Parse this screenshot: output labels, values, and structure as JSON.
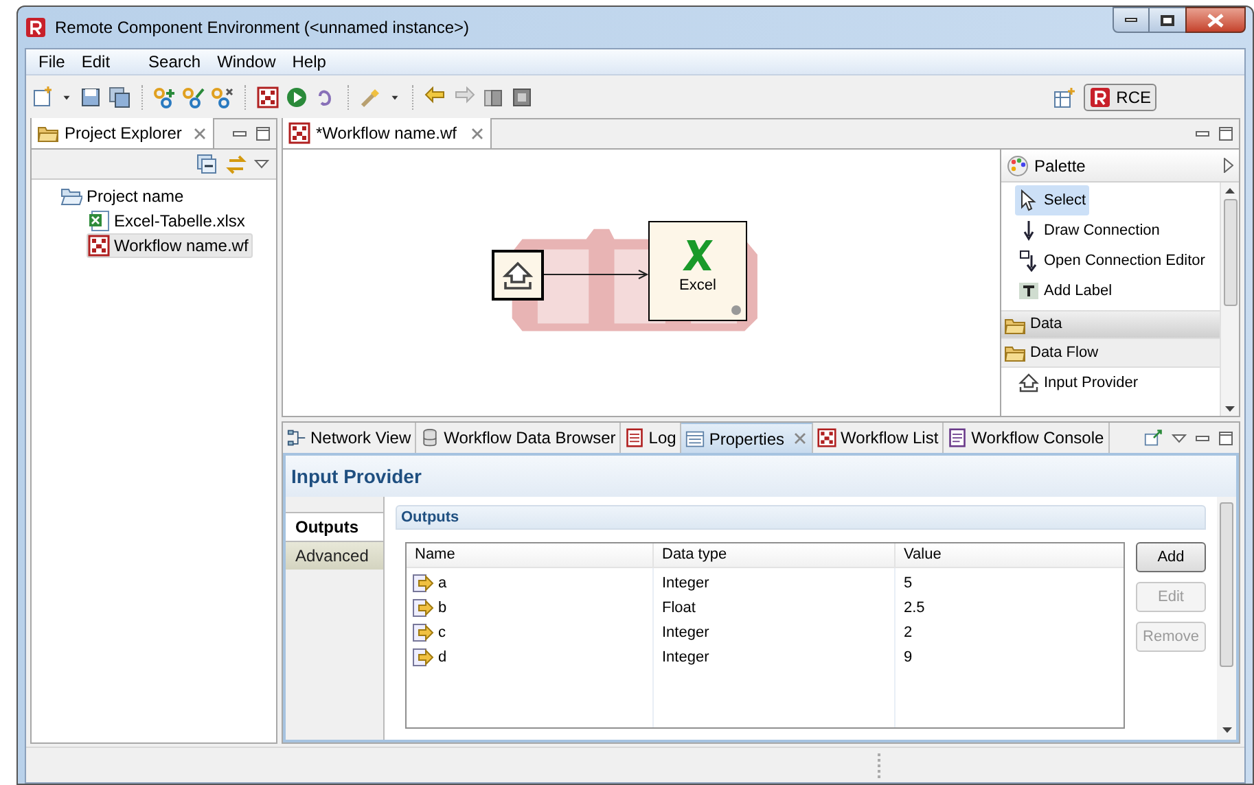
{
  "window": {
    "title": "Remote Component Environment (<unnamed instance>)"
  },
  "menu": [
    "File",
    "Edit",
    "Search",
    "Window",
    "Help"
  ],
  "perspective": {
    "label": "RCE",
    "selected": true
  },
  "project_explorer": {
    "title": "Project Explorer",
    "tree": [
      {
        "label": "Project name",
        "kind": "folder",
        "expanded": true,
        "selected": false,
        "children": [
          {
            "label": "Excel-Tabelle.xlsx",
            "kind": "excel",
            "selected": false
          },
          {
            "label": "Workflow name.wf",
            "kind": "workflow",
            "selected": true
          }
        ]
      }
    ]
  },
  "editor": {
    "tab": "*Workflow name.wf",
    "nodes": [
      {
        "kind": "input"
      },
      {
        "kind": "excel",
        "label": "Excel"
      }
    ]
  },
  "palette": {
    "title": "Palette",
    "items": [
      {
        "kind": "select",
        "label": "Select",
        "selected": true
      },
      {
        "kind": "connection",
        "label": "Draw Connection",
        "selected": false
      },
      {
        "kind": "editor",
        "label": "Open Connection Editor",
        "selected": false
      },
      {
        "kind": "label",
        "label": "Add Label",
        "selected": false
      },
      {
        "kind": "drawer",
        "label": "Data",
        "selected": true
      },
      {
        "kind": "drawer",
        "label": "Data Flow",
        "selected": false
      },
      {
        "kind": "input",
        "label": "Input Provider",
        "selected": false
      }
    ]
  },
  "bottom_tabs": [
    {
      "kind": "network",
      "label": "Network View",
      "selected": false
    },
    {
      "kind": "database",
      "label": "Workflow Data Browser",
      "selected": false
    },
    {
      "kind": "log",
      "label": "Log",
      "selected": false
    },
    {
      "kind": "properties",
      "label": "Properties",
      "selected": true
    },
    {
      "kind": "workflow",
      "label": "Workflow List",
      "selected": false
    },
    {
      "kind": "console",
      "label": "Workflow Console",
      "selected": false
    }
  ],
  "properties": {
    "title": "Input Provider",
    "side_tabs": [
      {
        "label": "Outputs",
        "selected": true
      },
      {
        "label": "Advanced",
        "selected": false
      }
    ],
    "section": "Outputs",
    "columns": [
      "Name",
      "Data type",
      "Value"
    ],
    "rows": [
      [
        "a",
        "Integer",
        "5"
      ],
      [
        "b",
        "Float",
        "2.5"
      ],
      [
        "c",
        "Integer",
        "2"
      ],
      [
        "d",
        "Integer",
        "9"
      ]
    ],
    "buttons": [
      {
        "label": "Add",
        "disabled": false
      },
      {
        "label": "Edit",
        "disabled": true
      },
      {
        "label": "Remove",
        "disabled": true
      }
    ]
  }
}
